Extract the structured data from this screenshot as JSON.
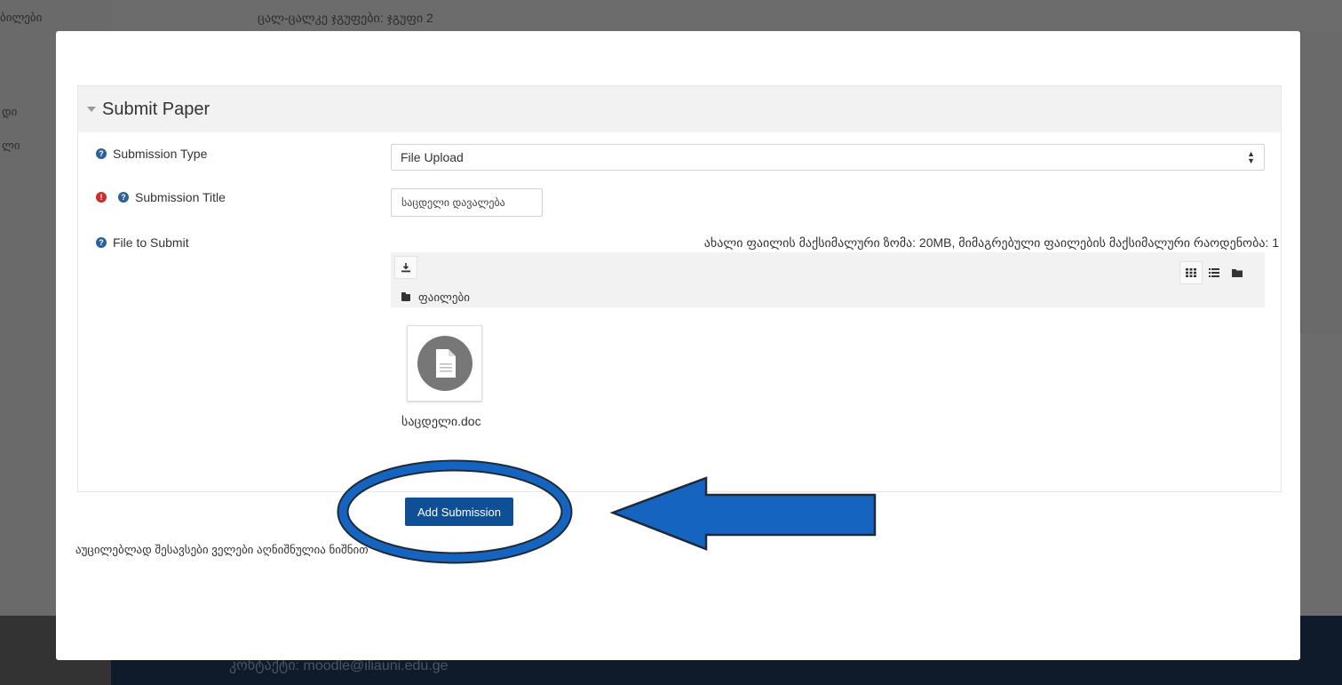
{
  "background": {
    "left_text_top": "ბილები",
    "left_text_2": "დი",
    "left_text_3": "ლი",
    "group_text": "ცალ-ცალკე ჯგუფები: ჯგუფი 2",
    "footer_contact": "კონტაქტი: moodle@iliauni.edu.ge"
  },
  "modal": {
    "section_title": "Submit Paper",
    "fields": {
      "submission_type": {
        "label": "Submission Type",
        "value": "File Upload",
        "help_icon": "question-circle-icon"
      },
      "submission_title": {
        "label": "Submission Title",
        "value": "საცდელი დავალება",
        "required_icon": "exclamation-circle-icon",
        "help_icon": "question-circle-icon"
      },
      "file_to_submit": {
        "label": "File to Submit",
        "help_icon": "question-circle-icon",
        "max_info": "ახალი ფაილის მაქსიმალური ზომა: 20MB, მიმაგრებული ფაილების მაქსიმალური რაოდენობა: 1",
        "folder_label": "ფაილები",
        "files": [
          {
            "name": "საცდელი.doc",
            "icon": "document-icon"
          }
        ]
      }
    },
    "submit_label": "Add Submission",
    "required_note": "აუცილებლად შესავსები ველები აღნიშნულია ნიშნით"
  },
  "colors": {
    "primary_button": "#0f4f96",
    "annotation_blue": "#1565c0",
    "help_icon": "#2b6198",
    "required_icon": "#c9302c"
  }
}
